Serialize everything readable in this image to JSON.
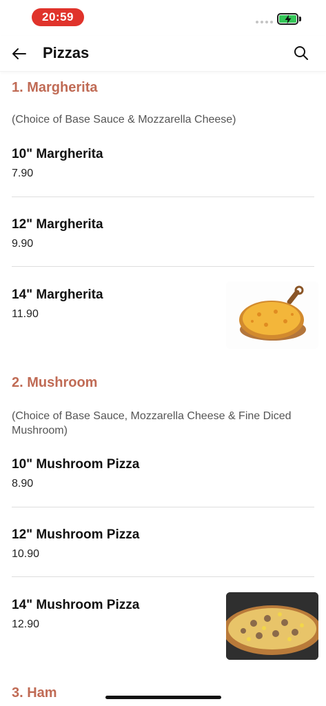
{
  "status_bar": {
    "time": "20:59",
    "battery_color": "#35c759"
  },
  "header": {
    "title": "Pizzas",
    "back_icon": "arrow-left-icon",
    "search_icon": "search-icon"
  },
  "sections": [
    {
      "title": "1. Margherita",
      "description": "(Choice of Base Sauce & Mozzarella Cheese)",
      "items": [
        {
          "name": "10\" Margherita",
          "price": "7.90"
        },
        {
          "name": "12\" Margherita",
          "price": "9.90"
        },
        {
          "name": "14\" Margherita",
          "price": "11.90",
          "image": "margherita-pizza-photo"
        }
      ]
    },
    {
      "title": "2. Mushroom",
      "description": "(Choice of Base Sauce, Mozzarella Cheese & Fine Diced Mushroom)",
      "items": [
        {
          "name": "10\" Mushroom Pizza",
          "price": "8.90"
        },
        {
          "name": "12\" Mushroom Pizza",
          "price": "10.90"
        },
        {
          "name": "14\" Mushroom Pizza",
          "price": "12.90",
          "image": "mushroom-pizza-photo"
        }
      ]
    },
    {
      "title": "3. Ham"
    }
  ],
  "accent_color": "#c06b55"
}
